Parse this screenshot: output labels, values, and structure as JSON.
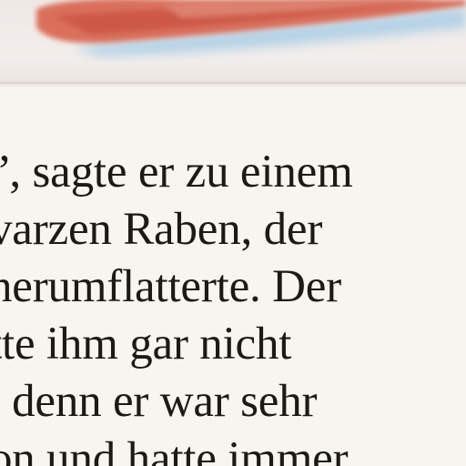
{
  "illustration": {
    "description_icon": "watercolor-illustration-edge",
    "colors": {
      "red": "#d8644e",
      "blue": "#a9cde6",
      "paper": "#f7f5f0"
    }
  },
  "text": {
    "lines": [
      "”, sagte er zu einem",
      "varzen Raben, der",
      "nerumflatterte. Der",
      "tte ihm gar nicht",
      ", denn er war sehr",
      "on und hatte immer"
    ]
  }
}
